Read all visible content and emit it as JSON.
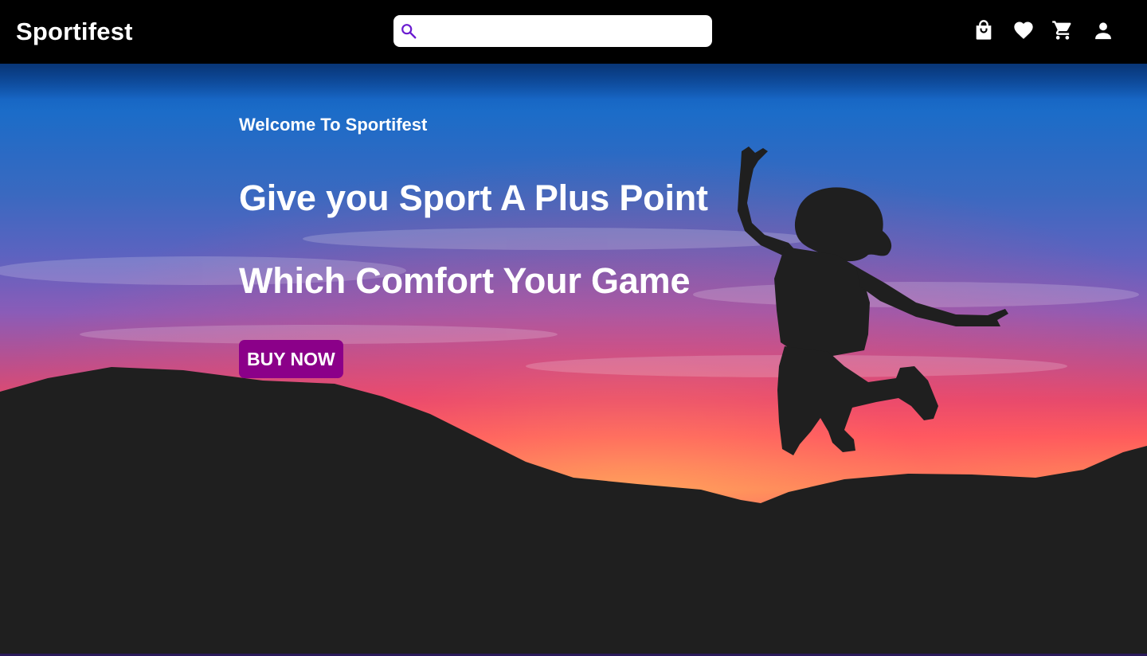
{
  "navbar": {
    "brand": "Sportifest",
    "search": {
      "placeholder": "",
      "value": "",
      "icon": "search-icon",
      "icon_color": "#6a1bd0"
    },
    "icons": [
      "shopping-bag-icon",
      "heart-icon",
      "cart-icon",
      "user-icon"
    ],
    "background": "#000000"
  },
  "hero": {
    "welcome": "Welcome To Sportifest",
    "headline_line1": "Give you Sport A Plus Point",
    "headline_line2": "Which Comfort Your Game",
    "cta_label": "BUY NOW",
    "cta_color": "#8b0089"
  }
}
